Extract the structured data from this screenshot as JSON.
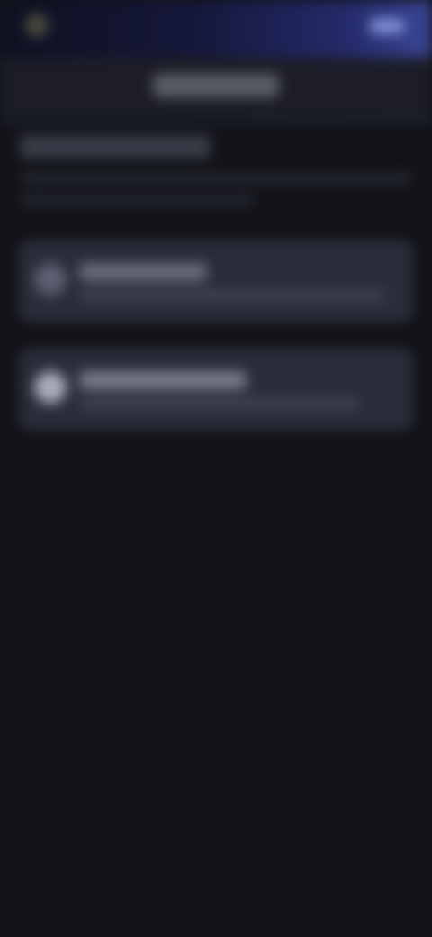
{
  "status_bar": {
    "app_icon": "app-logo-icon",
    "right_icon": "battery-icon"
  },
  "header": {
    "back_icon": "arrow-left-icon",
    "back_glyph": "‹"
  },
  "section": {},
  "cards": [
    {
      "icon": "option-icon"
    },
    {
      "icon": "option-icon"
    }
  ],
  "colors": {
    "background": "#121318",
    "header_gradient_end": "#3a4694",
    "card": "#2a2c3a"
  }
}
